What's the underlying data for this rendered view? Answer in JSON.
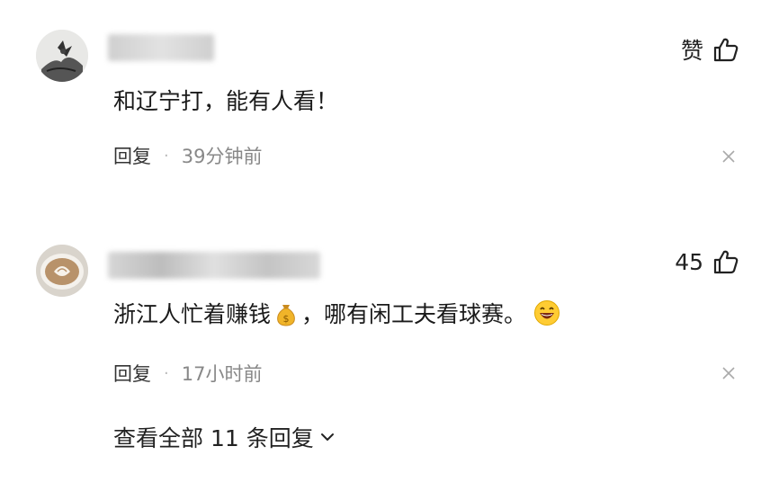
{
  "comments": [
    {
      "username": "████████",
      "like_label": "赞",
      "text": "和辽宁打，能有人看！",
      "reply_label": "回复",
      "separator": "·",
      "time": "39分钟前",
      "avatar_icon": "ink-painting-avatar",
      "close_icon": "close-icon"
    },
    {
      "username": "████████████",
      "like_label": "45",
      "text_before_emoji": "浙江人忙着赚钱",
      "emoji1": "money-bag-icon",
      "text_after_emoji": "，哪有闲工夫看球赛。",
      "emoji2": "grinning-face-icon",
      "reply_label": "回复",
      "separator": "·",
      "time": "17小时前",
      "avatar_icon": "latte-art-avatar",
      "close_icon": "close-icon"
    }
  ],
  "view_all_replies": "查看全部 11 条回复",
  "colors": {
    "text": "#1a1a1a",
    "meta": "#888888",
    "background": "#ffffff"
  }
}
